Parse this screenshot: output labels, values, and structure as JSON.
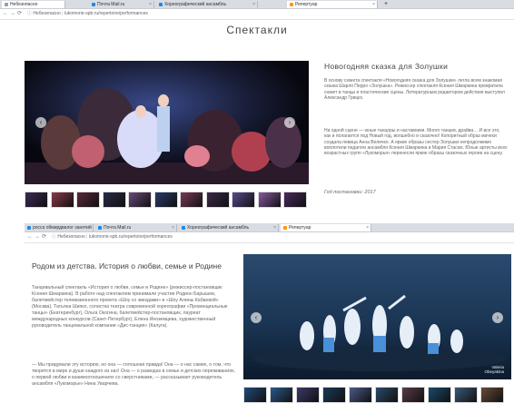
{
  "top_browser": {
    "tabs": [
      {
        "label": "Небезопасно",
        "active": true,
        "color": "#888888"
      },
      {
        "label": "Почта Mail.ru",
        "active": false,
        "color": "#1e88e5"
      },
      {
        "label": "Хореографический ансамбль",
        "active": false,
        "color": "#1e88e5"
      },
      {
        "label": "Репертуар",
        "active": false,
        "color": "#ff9800"
      }
    ],
    "url_security": "Небезопасно",
    "url": "lukomorie-spb.ru/repertoire/performances"
  },
  "page": {
    "title": "Спектакли"
  },
  "show1": {
    "title": "Новогодняя сказка для Золушки",
    "paragraph1": "В основу сюжета спектакля «Новогодняя сказка для Золушки» легла всем знакомая сказка Шарля Перро «Золушка». Режиссер спектакля Ксения Шмаркина превратила сюжет в танцы и пластические сцены. Литературным редактором действия выступил Александр Грицкх.",
    "paragraph2": "На одной сцене — юные танцоры и наставники. Много танцев, драйва… И все это, как и полагается под Новый год, волшебно и сказочно! Копоритный образ мачехи создала певица Анна Величко. А яркие образы сестер Золушки непродолжимо воплотили педагоги ансамбля Ксения Шмаркина и Мария Стасюк. Юные артисты всех возрастных групп «Лукоморья» перенесли яркие образы сказочных героев на сцену.",
    "year_text": "Год постановки: 2017",
    "thumb_count": 11
  },
  "bottom_browser": {
    "tabs": [
      {
        "label": "росса обмирдвалог занятий",
        "active": false,
        "color": "#1e88e5"
      },
      {
        "label": "Почта Mail.ru",
        "active": false,
        "color": "#1e88e5"
      },
      {
        "label": "Хореографический ансамбль",
        "active": false,
        "color": "#1e88e5"
      },
      {
        "label": "Репертуар",
        "active": true,
        "color": "#ff9800"
      }
    ],
    "url_security": "Небезопасно",
    "url": "lukomorie-spb.ru/repertoire/performances"
  },
  "show2": {
    "title": "Родом из детства. История о любви, семье и Родине",
    "paragraph1": "Танцевальный спектакль «История о любви, семье и Родине» (режиссер-постановщик Ксения Шмаркина). В работе над спектаклем принимали участие Родион Барышев, балетмейстер телевизионного проекта «Шоу со звездами» и «Шоу Алины Кабаевой» (Москва), Татьяна Шипко, солистка театра современной хореографии «Провинциальные танцы» (Екатеринбург), Ольга Окогина, балетмейстер-постановщик, лауреат международных конкурсов (Санкт-Петербург), Елена Иноземцева, художественный руководитель танцевальной компании «Дис-танция» (Калуга).",
    "paragraph2": "— Мы придумали эту историю, но она — сплошная правда! Она — о нас самих, о том, что творится в мире и душе каждого из нас! Она — о разводах в семье и детских переживаниях, о первой любви и взаимоотношениях со сверстниками, — рассказывает руководитель ансамбля «Лукоморье» Нина Уварчева.",
    "photo_caption": "Valeria Obeyakina",
    "thumb_count": 10
  },
  "colors": {
    "accent_text": "#444444",
    "body_text": "#666666",
    "chrome": "#d9dde3"
  }
}
